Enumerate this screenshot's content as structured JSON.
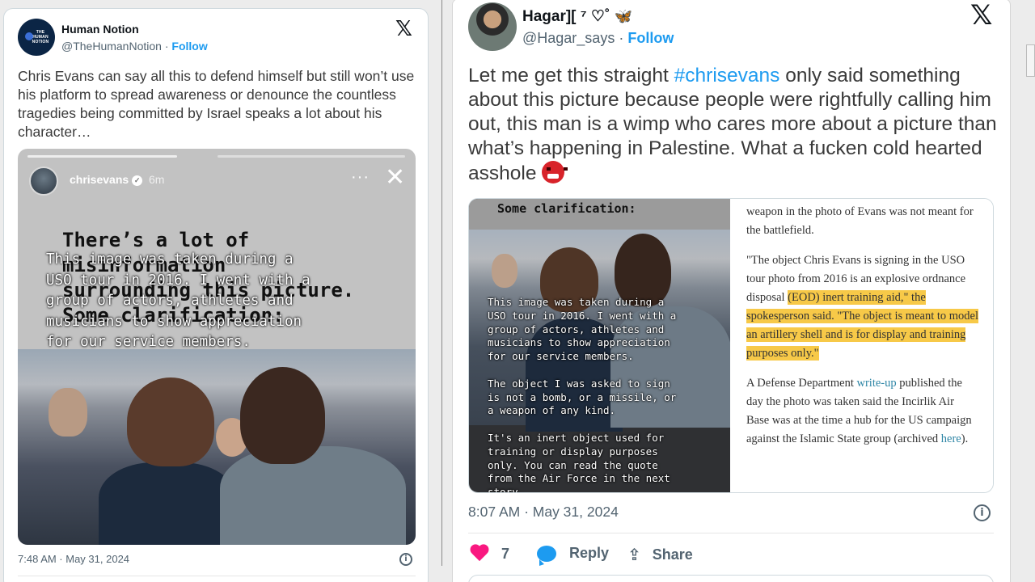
{
  "left_tweet": {
    "name": "Human Notion",
    "handle": "@TheHumanNotion",
    "separator": " · ",
    "follow_label": "Follow",
    "avatar_text": "THE HUMAN NOTION",
    "x_logo": "𝕏",
    "text": "Chris Evans can say all this to defend himself but still won’t use his platform to spread awareness or denounce the countless tragedies being committed by Israel speaks a lot about his character…",
    "story": {
      "username": "chrisevans",
      "time": "6m",
      "menu_glyph": "···",
      "close_glyph": "✕",
      "verified_glyph": "✓",
      "heading": "There’s a lot of\nmisinformation\nsurrounding this picture.\nSome clarification:",
      "caption": "This image was taken during a\nUSO tour in 2016. I went with a\ngroup of actors, athletes and\nmusicians to show appreciation\nfor our service members."
    },
    "timestamp": "7:48 AM · May 31, 2024",
    "info_glyph": "i"
  },
  "right_tweet": {
    "name": "Hagar",
    "name_suffix": "][ ⁷ ♡˚ ",
    "name_emoji": "🦋",
    "handle": "@Hagar_says",
    "separator": " · ",
    "follow_label": "Follow",
    "x_logo": "𝕏",
    "text_before": "Let me get this straight ",
    "hashtag": "#chrisevans",
    "text_after": " only said something about this picture because people were rightfully calling him out, this man is a wimp who cares more about a picture than what’s happening in Palestine. What a fucken cold hearted asshole ",
    "media": {
      "clarification_title": "Some clarification:",
      "caption": "This image was taken during a\nUSO tour in 2016. I went with a\ngroup of actors, athletes and\nmusicians to show appreciation\nfor our service members.\n\nThe object I was asked to sign\nis not a bomb, or a missile, or\na weapon of any kind.\n\nIt's an inert object used for\ntraining or display purposes\nonly. You can read the quote\nfrom the Air Force in the next\nstory.",
      "article_p1": "weapon in the photo of Evans was not meant for the battlefield.",
      "article_p2_a": "\"The object Chris Evans is signing in the USO tour photo from 2016 is an explosive ordnance disposal ",
      "article_p2_hl1": "(EOD) inert training aid,\" the spokesperson said. \"The object is meant to model an artillery shell and is for display and training purposes only.\"",
      "article_p3_a": "A Defense Department ",
      "article_p3_link1": "write-up",
      "article_p3_b": " published the day the photo was taken said the Incirlik Air Base was at the time a hub for the US campaign against the Islamic State group (archived ",
      "article_p3_link2": "here",
      "article_p3_c": ")."
    },
    "timestamp": "8:07 AM · May 31, 2024",
    "info_glyph": "i",
    "actions": {
      "like_count": "7",
      "reply_label": "Reply",
      "share_label": "Share",
      "share_glyph": "⇪"
    }
  },
  "colors": {
    "follow": "#1d9bf0",
    "like": "#f91880",
    "highlight": "#f7c948",
    "link": "#2f86a6"
  }
}
